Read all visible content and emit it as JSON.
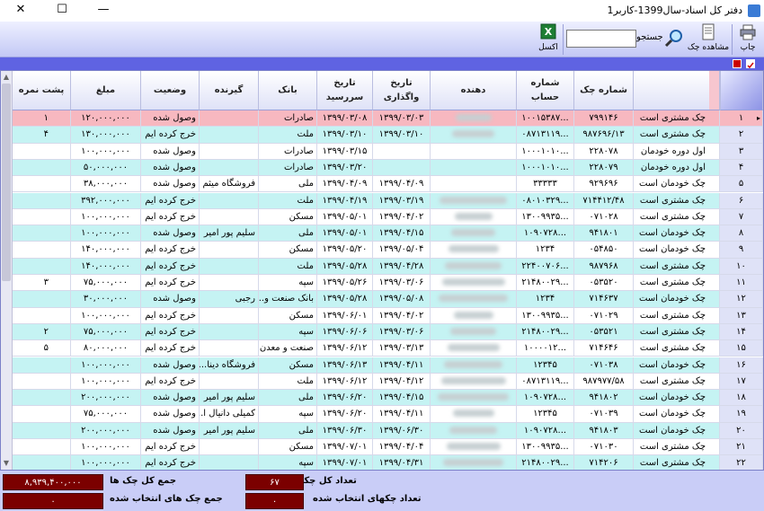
{
  "window": {
    "title": "دفتر کل اسناد-سال1399-کاربر1"
  },
  "toolbar": {
    "print_label": "چاپ",
    "view_cheque_label": "مشاهده چک",
    "search_label": "جستجو",
    "search_value": "",
    "excel_label": "اکسل"
  },
  "grid": {
    "headers": {
      "cheque_no": "شماره چک",
      "account_no": "شماره حساب",
      "giver": "دهنده",
      "assign_date": "تاریخ واگذاری",
      "due_date": "تاریخ سررسید",
      "bank": "بانک",
      "receiver": "گیرنده",
      "status": "وضعیت",
      "amount": "مبلغ",
      "back_note": "پشت نمره"
    },
    "rows": [
      {
        "idx": "۱",
        "type": "چک مشتری است",
        "cheque": "۷۹۹۱۴۶",
        "account": "...۱۰۰۱۵۳۸۷",
        "giver_blur": true,
        "assign": "۱۳۹۹/۰۳/۰۳",
        "due": "۱۳۹۹/۰۳/۰۸",
        "bank": "صادرات",
        "receiver": "",
        "status": "وصول شده",
        "amount": "۱۲۰,۰۰۰,۰۰۰",
        "back": "۱"
      },
      {
        "idx": "۲",
        "type": "چک مشتری است",
        "cheque": "۹۸۷۶۹۶/۱۳",
        "account": "...۰۸۷۱۳۱۱۹",
        "giver_blur": true,
        "assign": "۱۳۹۹/۰۳/۱۰",
        "due": "۱۳۹۹/۰۳/۱۰",
        "bank": "ملت",
        "receiver": "",
        "status": "خرج کرده ایم",
        "amount": "۱۳۰,۰۰۰,۰۰۰",
        "back": "۴"
      },
      {
        "idx": "۳",
        "type": "اول دوره خودمان",
        "cheque": "۲۲۸۰۷۸",
        "account": "...۱۰۰۰۱۰۱۰",
        "giver_blur": false,
        "assign": "",
        "due": "۱۳۹۹/۰۳/۱۵",
        "bank": "صادرات",
        "receiver": "",
        "status": "وصول شده",
        "amount": "۱۰۰,۰۰۰,۰۰۰",
        "back": ""
      },
      {
        "idx": "۴",
        "type": "اول دوره خودمان",
        "cheque": "۲۲۸۰۷۹",
        "account": "...۱۰۰۰۱۰۱۰",
        "giver_blur": false,
        "assign": "",
        "due": "۱۳۹۹/۰۳/۲۰",
        "bank": "صادرات",
        "receiver": "",
        "status": "وصول شده",
        "amount": "۵۰,۰۰۰,۰۰۰",
        "back": ""
      },
      {
        "idx": "۵",
        "type": "چک خودمان است",
        "cheque": "۹۲۹۶۹۶",
        "account": "۳۳۳۳۳",
        "giver_blur": false,
        "assign": "۱۳۹۹/۰۴/۰۹",
        "due": "۱۳۹۹/۰۴/۰۹",
        "bank": "ملی",
        "receiver": "فروشگاه میثم",
        "status": "وصول شده",
        "amount": "۳۸,۰۰۰,۰۰۰",
        "back": ""
      },
      {
        "idx": "۶",
        "type": "چک مشتری است",
        "cheque": "۷۱۴۴۱۲/۴۸",
        "account": "...۰۸۰۱۰۳۲۹",
        "giver_blur": true,
        "assign": "۱۳۹۹/۰۳/۱۹",
        "due": "۱۳۹۹/۰۴/۱۹",
        "bank": "ملت",
        "receiver": "",
        "status": "خرج کرده ایم",
        "amount": "۳۹۲,۰۰۰,۰۰۰",
        "back": ""
      },
      {
        "idx": "۷",
        "type": "چک مشتری است",
        "cheque": "۰۷۱۰۲۸",
        "account": "...۱۳۰۰۹۹۳۵",
        "giver_blur": true,
        "assign": "۱۳۹۹/۰۴/۰۲",
        "due": "۱۳۹۹/۰۵/۰۱",
        "bank": "مسکن",
        "receiver": "",
        "status": "خرج کرده ایم",
        "amount": "۱۰۰,۰۰۰,۰۰۰",
        "back": ""
      },
      {
        "idx": "۸",
        "type": "چک خودمان است",
        "cheque": "۹۴۱۸۰۱",
        "account": "...۱۰۹۰۷۲۸",
        "giver_blur": true,
        "assign": "۱۳۹۹/۰۴/۱۵",
        "due": "۱۳۹۹/۰۵/۰۱",
        "bank": "ملی",
        "receiver": "سلیم پور امیر",
        "status": "وصول شده",
        "amount": "۱۰۰,۰۰۰,۰۰۰",
        "back": ""
      },
      {
        "idx": "۹",
        "type": "چک خودمان است",
        "cheque": "۰۵۴۸۵۰",
        "account": "۱۲۳۴",
        "giver_blur": true,
        "assign": "۱۳۹۹/۰۵/۰۴",
        "due": "۱۳۹۹/۰۵/۲۰",
        "bank": "مسکن",
        "receiver": "",
        "status": "خرج کرده ایم",
        "amount": "۱۴۰,۰۰۰,۰۰۰",
        "back": ""
      },
      {
        "idx": "۱۰",
        "type": "چک مشتری است",
        "cheque": "۹۸۷۹۶۸",
        "account": "...۲۲۴۰۰۷۰۶",
        "giver_blur": true,
        "assign": "۱۳۹۹/۰۴/۲۸",
        "due": "۱۳۹۹/۰۵/۲۸",
        "bank": "ملت",
        "receiver": "",
        "status": "خرج کرده ایم",
        "amount": "۱۴۰,۰۰۰,۰۰۰",
        "back": ""
      },
      {
        "idx": "۱۱",
        "type": "چک مشتری است",
        "cheque": "۰۵۳۵۲۰",
        "account": "...۲۱۴۸۰۰۲۹",
        "giver_blur": true,
        "assign": "۱۳۹۹/۰۳/۰۶",
        "due": "۱۳۹۹/۰۵/۲۶",
        "bank": "سپه",
        "receiver": "",
        "status": "خرج کرده ایم",
        "amount": "۷۵,۰۰۰,۰۰۰",
        "back": "۳"
      },
      {
        "idx": "۱۲",
        "type": "چک خودمان است",
        "cheque": "۷۱۴۶۳۷",
        "account": "۱۲۳۴",
        "giver_blur": true,
        "assign": "۱۳۹۹/۰۵/۰۸",
        "due": "۱۳۹۹/۰۵/۲۸",
        "bank": "بانک صنعت و...",
        "receiver": "رجبی",
        "status": "وصول شده",
        "amount": "۳۰,۰۰۰,۰۰۰",
        "back": ""
      },
      {
        "idx": "۱۳",
        "type": "چک مشتری است",
        "cheque": "۰۷۱۰۲۹",
        "account": "...۱۳۰۰۹۹۳۵",
        "giver_blur": true,
        "assign": "۱۳۹۹/۰۴/۰۲",
        "due": "۱۳۹۹/۰۶/۰۱",
        "bank": "مسکن",
        "receiver": "",
        "status": "خرج کرده ایم",
        "amount": "۱۰۰,۰۰۰,۰۰۰",
        "back": ""
      },
      {
        "idx": "۱۴",
        "type": "چک مشتری است",
        "cheque": "۰۵۳۵۲۱",
        "account": "...۲۱۴۸۰۰۲۹",
        "giver_blur": true,
        "assign": "۱۳۹۹/۰۳/۰۶",
        "due": "۱۳۹۹/۰۶/۰۶",
        "bank": "سپه",
        "receiver": "",
        "status": "خرج کرده ایم",
        "amount": "۷۵,۰۰۰,۰۰۰",
        "back": "۲"
      },
      {
        "idx": "۱۵",
        "type": "چک مشتری است",
        "cheque": "۷۱۴۶۴۶",
        "account": "...۱۰۰۰۰۱۲",
        "giver_blur": true,
        "assign": "۱۳۹۹/۰۳/۱۳",
        "due": "۱۳۹۹/۰۶/۱۲",
        "bank": "صنعت و معدن",
        "receiver": "",
        "status": "خرج کرده ایم",
        "amount": "۸۰,۰۰۰,۰۰۰",
        "back": "۵"
      },
      {
        "idx": "۱۶",
        "type": "چک خودمان است",
        "cheque": "۰۷۱۰۳۸",
        "account": "۱۲۳۴۵",
        "giver_blur": true,
        "assign": "۱۳۹۹/۰۴/۱۱",
        "due": "۱۳۹۹/۰۶/۱۳",
        "bank": "مسکن",
        "receiver": "فروشگاه دینا...",
        "status": "وصول شده",
        "amount": "۱۰۰,۰۰۰,۰۰۰",
        "back": ""
      },
      {
        "idx": "۱۷",
        "type": "چک مشتری است",
        "cheque": "۹۸۷۹۷۷/۵۸",
        "account": "...۰۸۷۱۳۱۱۹",
        "giver_blur": true,
        "assign": "۱۳۹۹/۰۴/۱۲",
        "due": "۱۳۹۹/۰۶/۱۲",
        "bank": "ملت",
        "receiver": "",
        "status": "خرج کرده ایم",
        "amount": "۱۰۰,۰۰۰,۰۰۰",
        "back": ""
      },
      {
        "idx": "۱۸",
        "type": "چک خودمان است",
        "cheque": "۹۴۱۸۰۲",
        "account": "...۱۰۹۰۷۲۸",
        "giver_blur": true,
        "assign": "۱۳۹۹/۰۴/۱۵",
        "due": "۱۳۹۹/۰۶/۲۰",
        "bank": "ملی",
        "receiver": "سلیم پور امیر",
        "status": "وصول شده",
        "amount": "۲۰۰,۰۰۰,۰۰۰",
        "back": ""
      },
      {
        "idx": "۱۹",
        "type": "چک خودمان است",
        "cheque": "۰۷۱۰۳۹",
        "account": "۱۲۳۴۵",
        "giver_blur": true,
        "assign": "۱۳۹۹/۰۴/۱۱",
        "due": "۱۳۹۹/۰۶/۲۰",
        "bank": "سپه",
        "receiver": "کمیلی دانیال ا...",
        "status": "وصول شده",
        "amount": "۷۵,۰۰۰,۰۰۰",
        "back": ""
      },
      {
        "idx": "۲۰",
        "type": "چک خودمان است",
        "cheque": "۹۴۱۸۰۳",
        "account": "...۱۰۹۰۷۲۸",
        "giver_blur": true,
        "assign": "۱۳۹۹/۰۶/۳۰",
        "due": "۱۳۹۹/۰۶/۳۰",
        "bank": "ملی",
        "receiver": "سلیم پور امیر",
        "status": "وصول شده",
        "amount": "۲۰۰,۰۰۰,۰۰۰",
        "back": ""
      },
      {
        "idx": "۲۱",
        "type": "چک مشتری است",
        "cheque": "۰۷۱۰۳۰",
        "account": "...۱۳۰۰۹۹۳۵",
        "giver_blur": true,
        "assign": "۱۳۹۹/۰۴/۰۴",
        "due": "۱۳۹۹/۰۷/۰۱",
        "bank": "مسکن",
        "receiver": "",
        "status": "خرج کرده ایم",
        "amount": "۱۰۰,۰۰۰,۰۰۰",
        "back": ""
      },
      {
        "idx": "۲۲",
        "type": "چک مشتری است",
        "cheque": "۷۱۴۲۰۶",
        "account": "...۲۱۴۸۰۰۲۹",
        "giver_blur": true,
        "assign": "۱۳۹۹/۰۴/۳۱",
        "due": "۱۳۹۹/۰۷/۰۱",
        "bank": "سپه",
        "receiver": "",
        "status": "خرج کرده ایم",
        "amount": "۱۰۰,۰۰۰,۰۰۰",
        "back": ""
      }
    ]
  },
  "footer": {
    "total_count_label": "تعداد کل چکها",
    "total_count_value": "۶۷",
    "selected_count_label": "تعداد چکهای انتخاب شده",
    "selected_count_value": "۰",
    "total_sum_label": "جمع کل چک ها",
    "total_sum_value": "۸,۹۳۹,۴۰۰,۰۰۰",
    "selected_sum_label": "جمع چک های انتخاب شده",
    "selected_sum_value": "۰"
  },
  "colors": {
    "selected_row": "#f7b8c0",
    "alt_row": "#c5f3f3",
    "row": "#ffffff",
    "header_strip": "#5f63e2",
    "footer_box": "#7b0000"
  }
}
